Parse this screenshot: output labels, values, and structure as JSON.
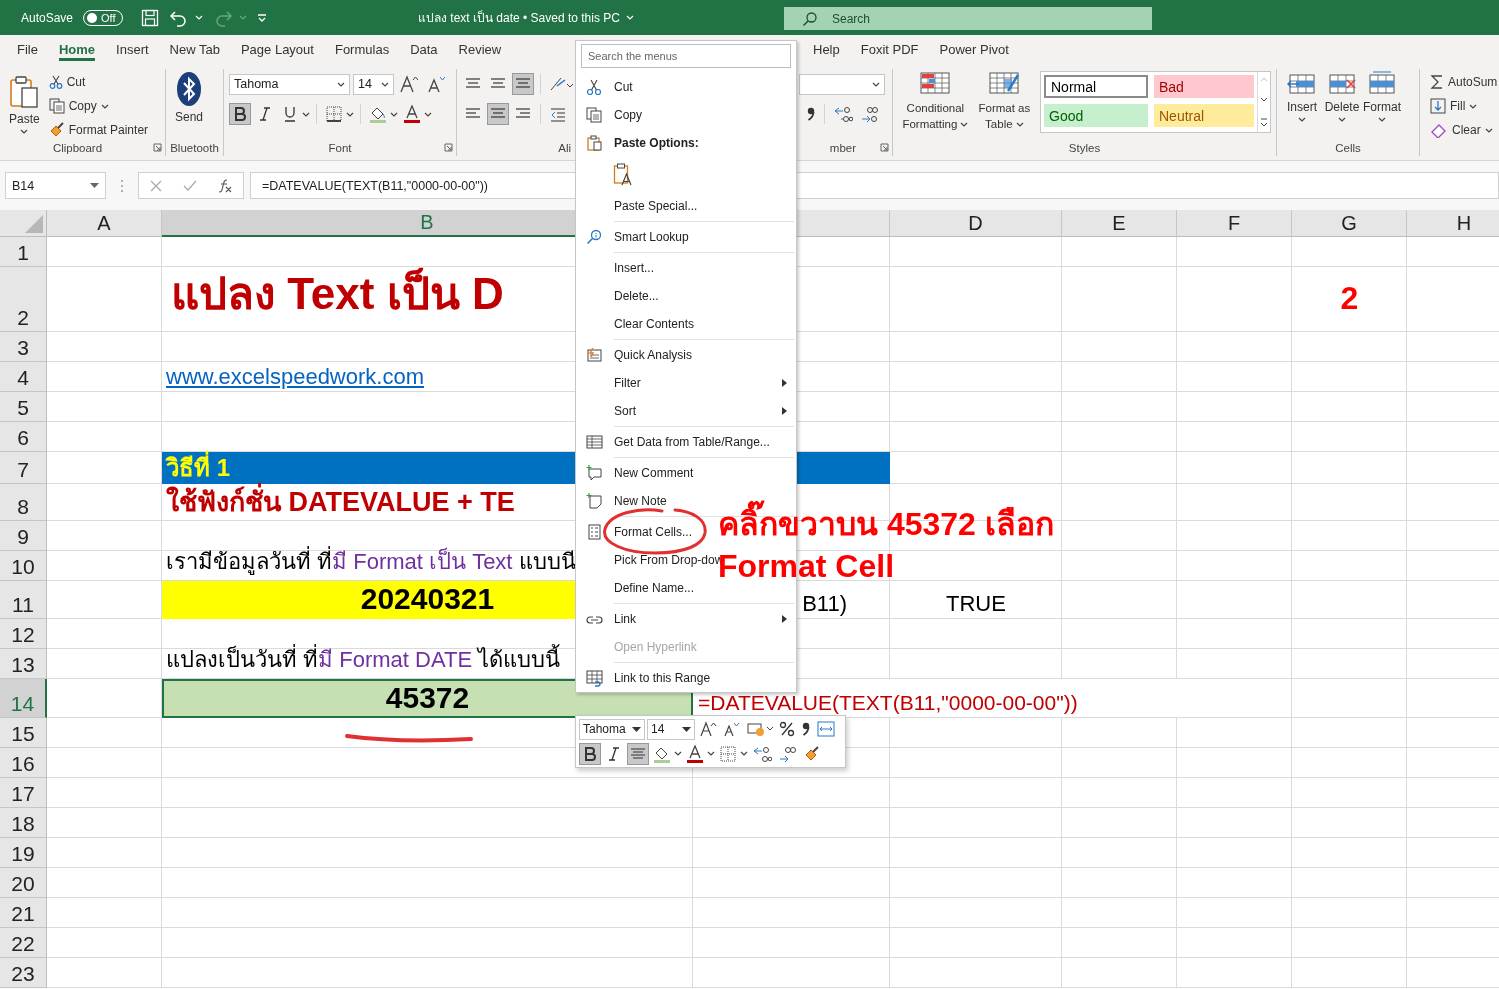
{
  "title_bar": {
    "autosave_label": "AutoSave",
    "autosave_state": "Off",
    "autosave_on": false,
    "document_title": "แปลง text เป็น date  •  Saved to this PC",
    "search_placeholder": "Search"
  },
  "tabs": [
    {
      "label": "File",
      "selected": false
    },
    {
      "label": "Home",
      "selected": true
    },
    {
      "label": "Insert",
      "selected": false
    },
    {
      "label": "New Tab",
      "selected": false
    },
    {
      "label": "Page Layout",
      "selected": false
    },
    {
      "label": "Formulas",
      "selected": false
    },
    {
      "label": "Data",
      "selected": false
    },
    {
      "label": "Review",
      "selected": false
    }
  ],
  "more_tabs": [
    {
      "label": "Help",
      "selected": false
    },
    {
      "label": "Foxit PDF",
      "selected": false
    },
    {
      "label": "Power Pivot",
      "selected": false
    }
  ],
  "ribbon": {
    "clipboard": {
      "label": "Clipboard",
      "paste": "Paste",
      "cut": "Cut",
      "copy": "Copy",
      "format_painter": "Format Painter"
    },
    "bluetooth": {
      "label": "Bluetooth",
      "send": "Send"
    },
    "font": {
      "label": "Font",
      "font_name": "Tahoma",
      "font_size": "14",
      "bold": true,
      "italic": false,
      "underline": false
    },
    "alignment": {
      "label": "Ali",
      "align_bottom": true,
      "align_center": true
    },
    "number": {
      "label": "mber"
    },
    "styles": {
      "label": "Styles",
      "conditional": "Conditional Formatting",
      "format_table": "Format as Table",
      "cell_styles": [
        {
          "label": "Normal",
          "kind": "normal",
          "selected": true
        },
        {
          "label": "Bad",
          "kind": "bad",
          "selected": false
        },
        {
          "label": "Good",
          "kind": "good",
          "selected": false
        },
        {
          "label": "Neutral",
          "kind": "neutral",
          "selected": false
        }
      ]
    },
    "cells": {
      "label": "Cells",
      "insert": "Insert",
      "delete": "Delete",
      "format": "Format"
    },
    "editing": {
      "autosum": "AutoSum",
      "fill": "Fill",
      "clear": "Clear"
    }
  },
  "formula_bar": {
    "name_box": "B14",
    "formula": "=DATEVALUE(TEXT(B11,\"0000-00-00\"))"
  },
  "sheet": {
    "columns": [
      {
        "label": "A",
        "selected": false
      },
      {
        "label": "B",
        "selected": true
      },
      {
        "selected": false
      },
      {
        "label": "D",
        "selected": false
      },
      {
        "label": "E",
        "selected": false
      },
      {
        "label": "F",
        "selected": false
      },
      {
        "label": "G",
        "selected": false
      },
      {
        "label": "H",
        "selected": false
      }
    ],
    "rows": [
      {
        "number": "1",
        "selected": false
      },
      {
        "number": "2",
        "selected": false,
        "cells": {
          "b": {
            "kind": "title",
            "text": "แปลง Text เป็น D"
          },
          "g": {
            "kind": "marker",
            "text": "2"
          }
        }
      },
      {
        "number": "3",
        "selected": false
      },
      {
        "number": "4",
        "selected": false,
        "cells": {
          "b": {
            "kind": "link",
            "text": "www.excelspeedwork.com"
          }
        }
      },
      {
        "number": "5",
        "selected": false
      },
      {
        "number": "6",
        "selected": false
      },
      {
        "number": "7",
        "selected": false,
        "cells": {
          "b": {
            "kind": "banner",
            "text": "วิธีที่ 1"
          }
        }
      },
      {
        "number": "8",
        "selected": false,
        "cells": {
          "b": {
            "kind": "subtitle",
            "text": "ใช้ฟังก์ชั่น DATEVALUE + TE"
          }
        }
      },
      {
        "number": "9",
        "selected": false
      },
      {
        "number": "10",
        "selected": false,
        "cells": {
          "b": {
            "kind": "mixed",
            "parts": [
              {
                "text": "เรามีข้อมูลวันที่ ที่",
                "accent": false
              },
              {
                "text": "มี Format เป็น Text",
                "accent": true
              },
              {
                "text": " แบบนี",
                "accent": false
              }
            ]
          }
        }
      },
      {
        "number": "11",
        "selected": false,
        "cells": {
          "b": {
            "kind": "input",
            "text": "20240321"
          },
          "c": {
            "kind": "overflow",
            "text": "B11)"
          },
          "d": {
            "kind": "plain",
            "text": "TRUE"
          }
        }
      },
      {
        "number": "12",
        "selected": false
      },
      {
        "number": "13",
        "selected": false,
        "cells": {
          "b": {
            "kind": "mixed",
            "parts": [
              {
                "text": "แปลงเป็นวันที่ ที่",
                "accent": false
              },
              {
                "text": "มี Format  DATE",
                "accent": true
              },
              {
                "text": " ได้แบบนี้",
                "accent": false
              }
            ]
          }
        }
      },
      {
        "number": "14",
        "selected": true,
        "cells": {
          "b": {
            "kind": "result",
            "text": "45372",
            "selected": true
          },
          "c": {
            "kind": "formula",
            "text": "=DATEVALUE(TEXT(B11,\"0000-00-00\"))"
          }
        }
      },
      {
        "number": "15",
        "selected": false
      },
      {
        "number": "16",
        "selected": false
      },
      {
        "number": "17",
        "selected": false
      },
      {
        "number": "18",
        "selected": false
      },
      {
        "number": "19",
        "selected": false
      },
      {
        "number": "20",
        "selected": false
      },
      {
        "number": "21",
        "selected": false
      },
      {
        "number": "22",
        "selected": false
      },
      {
        "number": "23",
        "selected": false
      }
    ]
  },
  "context_menu": {
    "search_placeholder": "Search the menus",
    "items": [
      {
        "kind": "cut",
        "label": "Cut",
        "disabled": false,
        "submenu": false
      },
      {
        "kind": "copy",
        "label": "Copy",
        "disabled": false,
        "submenu": false
      },
      {
        "kind": "heading",
        "label": "Paste Options:",
        "disabled": false,
        "submenu": false
      },
      {
        "kind": "paste"
      },
      {
        "kind": "plain",
        "label": "Paste Special...",
        "disabled": false,
        "submenu": false
      },
      {
        "kind": "separator"
      },
      {
        "kind": "lookup",
        "label": "Smart Lookup",
        "disabled": false,
        "submenu": false
      },
      {
        "kind": "separator"
      },
      {
        "kind": "plain",
        "label": "Insert...",
        "disabled": false,
        "submenu": false
      },
      {
        "kind": "plain",
        "label": "Delete...",
        "disabled": false,
        "submenu": false
      },
      {
        "kind": "plain",
        "label": "Clear Contents",
        "disabled": false,
        "submenu": false
      },
      {
        "kind": "separator"
      },
      {
        "kind": "analysis",
        "label": "Quick Analysis",
        "disabled": false,
        "submenu": false
      },
      {
        "kind": "plain",
        "label": "Filter",
        "disabled": false,
        "submenu": true
      },
      {
        "kind": "plain",
        "label": "Sort",
        "disabled": false,
        "submenu": true
      },
      {
        "kind": "separator"
      },
      {
        "kind": "table",
        "label": "Get Data from Table/Range...",
        "disabled": false,
        "submenu": false
      },
      {
        "kind": "separator"
      },
      {
        "kind": "comment",
        "label": "New Comment",
        "disabled": false,
        "submenu": false
      },
      {
        "kind": "note",
        "label": "New Note",
        "disabled": false,
        "submenu": false
      },
      {
        "kind": "separator"
      },
      {
        "kind": "cells",
        "label": "Format Cells...",
        "disabled": false,
        "submenu": false
      },
      {
        "kind": "plain",
        "label": "Pick From Drop-dow",
        "disabled": false,
        "submenu": false
      },
      {
        "kind": "plain",
        "label": "Define Name...",
        "disabled": false,
        "submenu": false
      },
      {
        "kind": "separator"
      },
      {
        "kind": "link",
        "label": "Link",
        "disabled": false,
        "submenu": true
      },
      {
        "kind": "plain",
        "label": "Open Hyperlink",
        "disabled": true,
        "submenu": false
      },
      {
        "kind": "separator"
      },
      {
        "kind": "range",
        "label": "Link to this Range",
        "disabled": false,
        "submenu": false
      }
    ]
  },
  "mini_toolbar": {
    "font_name": "Tahoma",
    "font_size": "14",
    "bold": true,
    "center": true
  },
  "annotation": {
    "lines": [
      "คลิ๊กขวาบน 45372 เลือก",
      "Format Cell"
    ]
  }
}
